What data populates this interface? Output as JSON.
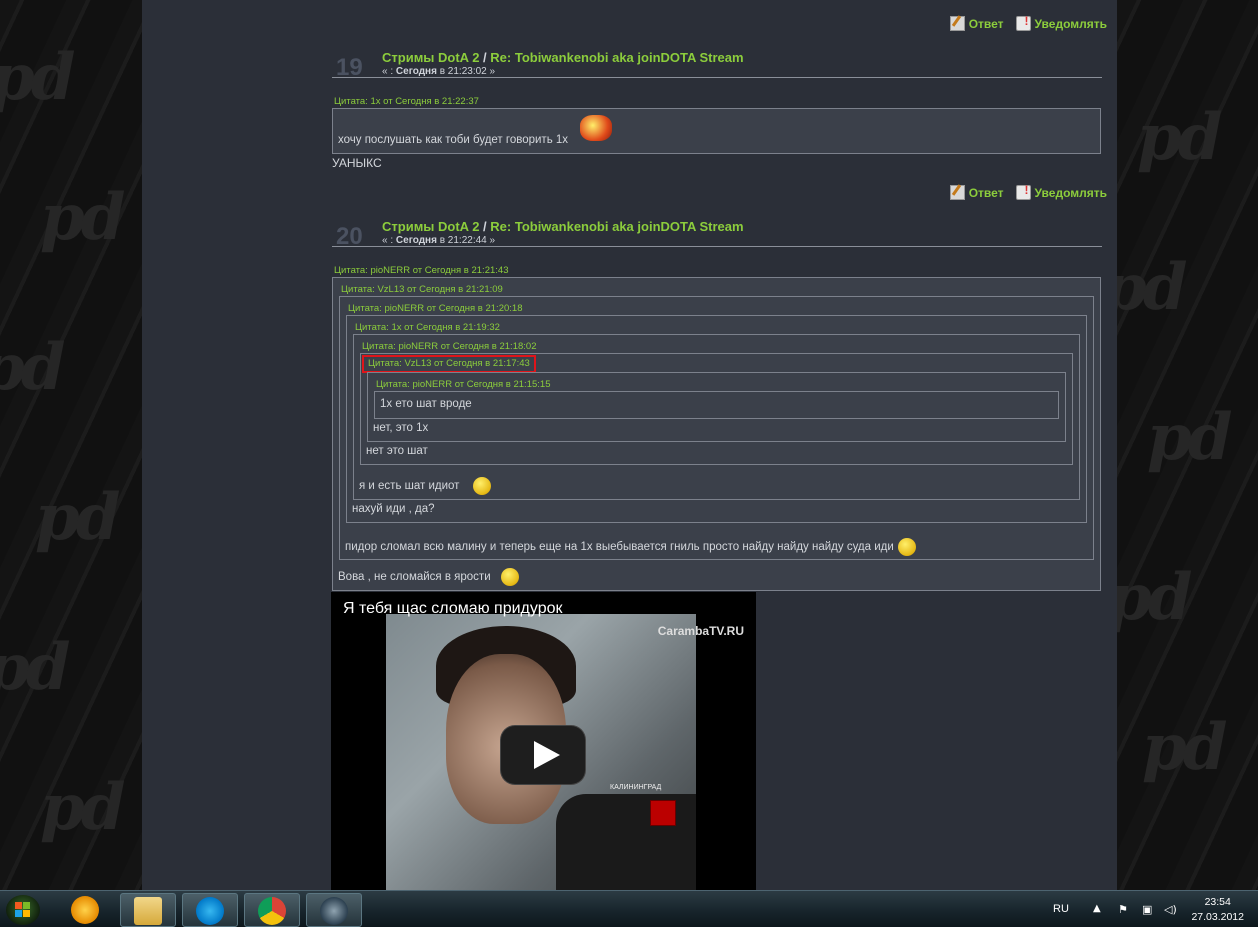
{
  "actions": {
    "reply": "Ответ",
    "notify": "Уведомлять"
  },
  "post19": {
    "num": "19",
    "board": "Стримы DotA 2",
    "sep": " / ",
    "topic": "Re: Tobiwankenobi aka joinDOTA Stream",
    "date_prefix": "« : ",
    "date_day": "Сегодня",
    "date_rest": " в 21:23:02 »",
    "quote_header": "Цитата: 1x от Сегодня в 21:22:37",
    "quote_text": "хочу послушать как тоби будет говорить 1х",
    "body": "УАНЫКС"
  },
  "post20": {
    "num": "20",
    "board": "Стримы DotA 2",
    "sep": " / ",
    "topic": "Re: Tobiwankenobi aka joinDOTA Stream",
    "date_prefix": "« : ",
    "date_day": "Сегодня",
    "date_rest": " в 21:22:44 »",
    "quotes": [
      {
        "header": "Цитата: pioNERR от Сегодня в 21:21:43",
        "text": "пидор сломал всю малину и теперь еще на 1х выебывается гниль просто найду найду найду суда иди"
      },
      {
        "header": "Цитата: VzL13 от Сегодня в 21:21:09",
        "text": "нахуй иди , да?"
      },
      {
        "header": "Цитата: pioNERR от Сегодня в 21:20:18",
        "text": "я и есть шат идиот"
      },
      {
        "header": "Цитата: 1x от Сегодня в 21:19:32",
        "text": "нет это шат"
      },
      {
        "header": "Цитата: pioNERR от Сегодня в 21:18:02",
        "text": ""
      },
      {
        "header": "Цитата: VzL13 от Сегодня в 21:17:43",
        "text": "нет, это 1х"
      },
      {
        "header": "Цитата: pioNERR от Сегодня в 21:15:15",
        "text": "1х ето шат вроде"
      }
    ],
    "body": "Вова , не сломайся в ярости"
  },
  "video": {
    "title": "Я тебя щас сломаю придурок",
    "logo": "CarambaTV.RU",
    "badge_text": "КАЛИНИНГРАД"
  },
  "taskbar": {
    "apps": [
      "aimp",
      "file-explorer",
      "skype",
      "chrome",
      "steam"
    ],
    "lang": "RU",
    "time": "23:54",
    "date": "27.03.2012"
  },
  "colors": {
    "link_green": "#8ccd3c",
    "forum_bg": "#2b2f38",
    "highlight_red": "#e0141a"
  }
}
